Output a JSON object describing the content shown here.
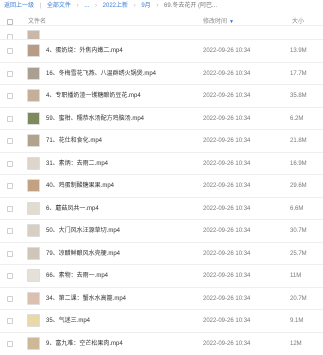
{
  "breadcrumb": {
    "back": "返回上一级",
    "items": [
      "全部文件",
      "...",
      "2022上新",
      "9月"
    ],
    "current": "69.冬去花开 (阿巴..."
  },
  "columns": {
    "name": "文件名",
    "modified": "修改时间",
    "size": "大小"
  },
  "files": [
    {
      "name": "",
      "time": "",
      "size": "",
      "thumb_color": "#c9b8a8"
    },
    {
      "name": "4、蛋奶烧：外焦内嫩二.mp4",
      "time": "2022-09-26 10:34",
      "size": "13.9M",
      "thumb_color": "#b99c87"
    },
    {
      "name": "16、冬梅雪花飞燕、八温群绣火锅煲.mp4",
      "time": "2022-09-26 10:34",
      "size": "17.7M",
      "thumb_color": "#a99f92"
    },
    {
      "name": "4、专职播奶渣一镬糖酿奶豆花.mp4",
      "time": "2022-09-26 10:34",
      "size": "35.8M",
      "thumb_color": "#c4b09a"
    },
    {
      "name": "59、蜜柑、糯恭水汤配方鸡脑汤.mp4",
      "time": "2022-09-26 10:34",
      "size": "6.2M",
      "thumb_color": "#7c8a5c"
    },
    {
      "name": "71、花仕和食化.mp4",
      "time": "2022-09-26 10:34",
      "size": "21.8M",
      "thumb_color": "#b2a48c"
    },
    {
      "name": "31、素炳：去雨二.mp4",
      "time": "2022-09-26 10:34",
      "size": "16.9M",
      "thumb_color": "#ddd6cc"
    },
    {
      "name": "40、鸡蛋制酸糖果果.mp4",
      "time": "2022-09-26 10:34",
      "size": "29.6M",
      "thumb_color": "#c4a183"
    },
    {
      "name": "6、蘑菇凤共一.mp4",
      "time": "2022-09-26 10:34",
      "size": "6.6M",
      "thumb_color": "#e2dbcf"
    },
    {
      "name": "50、大门风水汪源草切.mp4",
      "time": "2022-09-26 10:34",
      "size": "30.7M",
      "thumb_color": "#d8cfc3"
    },
    {
      "name": "79、凉醋鲜酿风水壳梗.mp4",
      "time": "2022-09-26 10:34",
      "size": "25.7M",
      "thumb_color": "#cfc6ba"
    },
    {
      "name": "66、素物：去雨一.mp4",
      "time": "2022-09-26 10:34",
      "size": "11M",
      "thumb_color": "#e5e0d8"
    },
    {
      "name": "34、第二课：蟹水水高籠.mp4",
      "time": "2022-09-26 10:34",
      "size": "20.7M",
      "thumb_color": "#dcbfae"
    },
    {
      "name": "35、气迷三.mp4",
      "time": "2022-09-26 10:34",
      "size": "9.1M",
      "thumb_color": "#e8d9a6"
    },
    {
      "name": "9、富九难：空芒松果肉.mp4",
      "time": "2022-09-26 10:34",
      "size": "12M",
      "thumb_color": "#cdb89a"
    }
  ]
}
